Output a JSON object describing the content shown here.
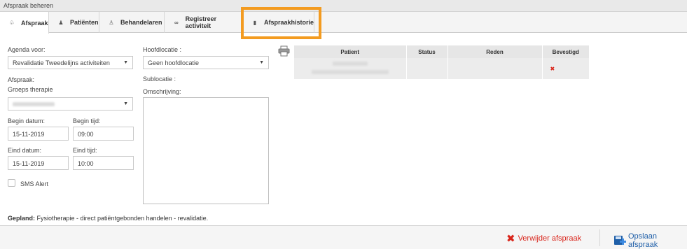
{
  "window": {
    "title": "Afspraak beheren"
  },
  "tabs": [
    {
      "label": "Afspraak",
      "icon": "stethoscope-icon",
      "glyph": "♧"
    },
    {
      "label": "Patiënten",
      "icon": "person-icon",
      "glyph": "♟"
    },
    {
      "label": "Behandelaren",
      "icon": "doctor-icon",
      "glyph": "♙"
    },
    {
      "label": "Registreer activiteit",
      "icon": "link-icon",
      "glyph": "∞"
    },
    {
      "label": "Afspraakhistorie",
      "icon": "book-icon",
      "glyph": "▮"
    }
  ],
  "form": {
    "agenda_label": "Agenda voor:",
    "agenda_value": "Revalidatie Tweedelijns activiteiten",
    "afspraak_label": "Afspraak:",
    "afspraak_value": "Groeps therapie",
    "begin_datum_label": "Begin datum:",
    "begin_datum_value": "15-11-2019",
    "begin_tijd_label": "Begin tijd:",
    "begin_tijd_value": "09:00",
    "eind_datum_label": "Eind datum:",
    "eind_datum_value": "15-11-2019",
    "eind_tijd_label": "Eind tijd:",
    "eind_tijd_value": "10:00",
    "sms_label": "SMS Alert",
    "hoofdlocatie_label": "Hoofdlocatie :",
    "hoofdlocatie_value": "Geen hoofdlocatie",
    "sublocatie_label": "Sublocatie :",
    "omschrijving_label": "Omschrijving:"
  },
  "gepland": {
    "label": "Gepland:",
    "text": " Fysiotherapie - direct patiëntgebonden handelen - revalidatie."
  },
  "table": {
    "headers": [
      "Patient",
      "Status",
      "Reden",
      "Bevestigd"
    ],
    "bevestigd_mark": "✖"
  },
  "footer": {
    "delete_label": "Verwijder afspraak",
    "save_label": "Opslaan afspraak"
  },
  "colors": {
    "highlight": "#f39b20",
    "delete": "#d9261c",
    "save": "#1f5fa8"
  }
}
